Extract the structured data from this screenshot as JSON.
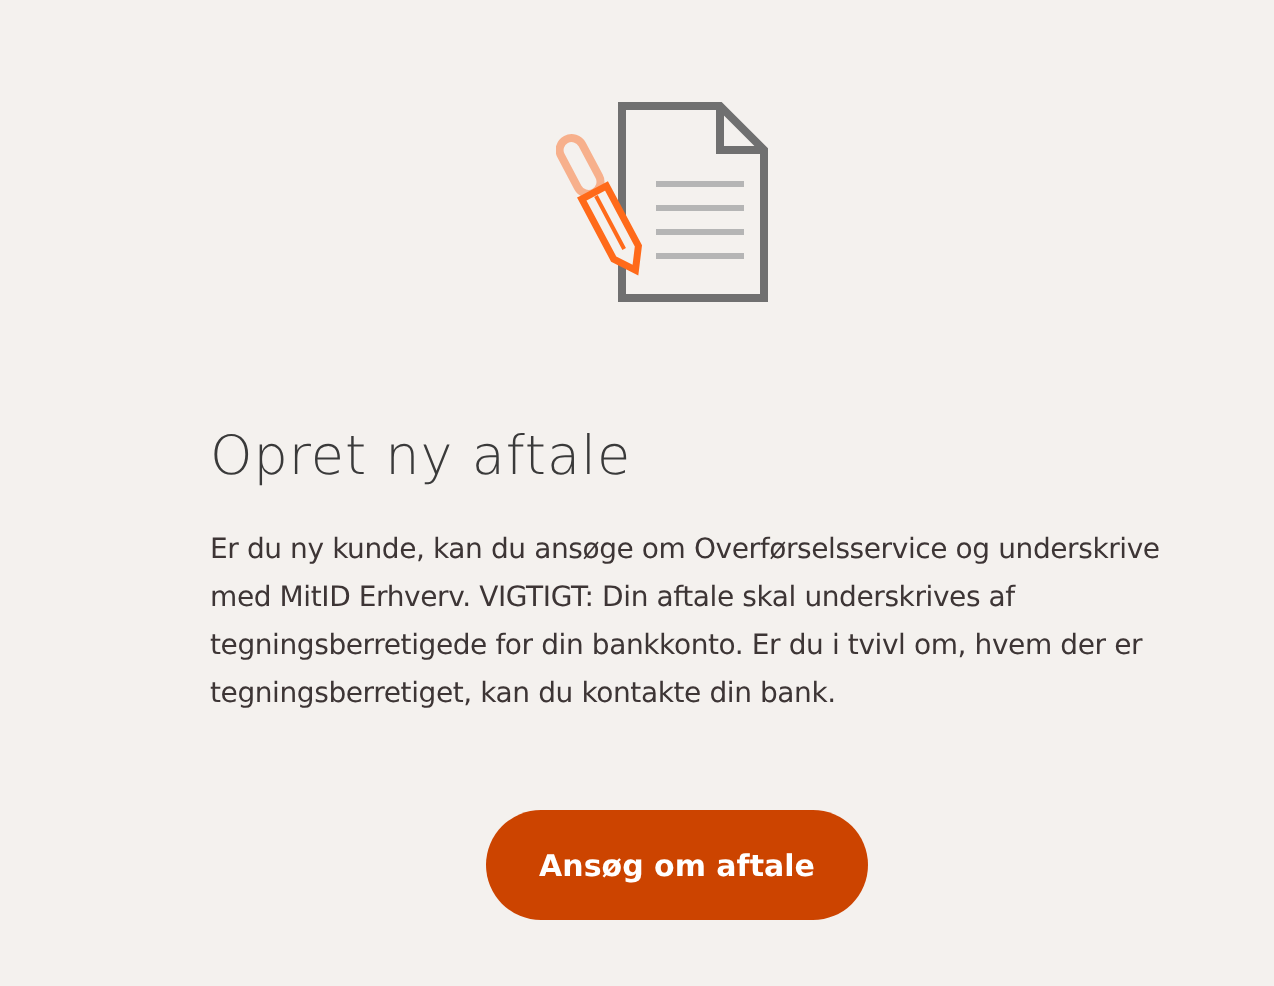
{
  "heading": "Opret ny aftale",
  "description": "Er du ny kunde, kan du ansøge om Overførselsservice og underskrive med MitID Erhverv. VIGTIGT: Din aftale skal underskrives af tegningsberretigede for din bankkonto. Er du i tvivl om, hvem der er tegningsberretiget, kan du kontakte din bank.",
  "button": {
    "label": "Ansøg om aftale"
  }
}
